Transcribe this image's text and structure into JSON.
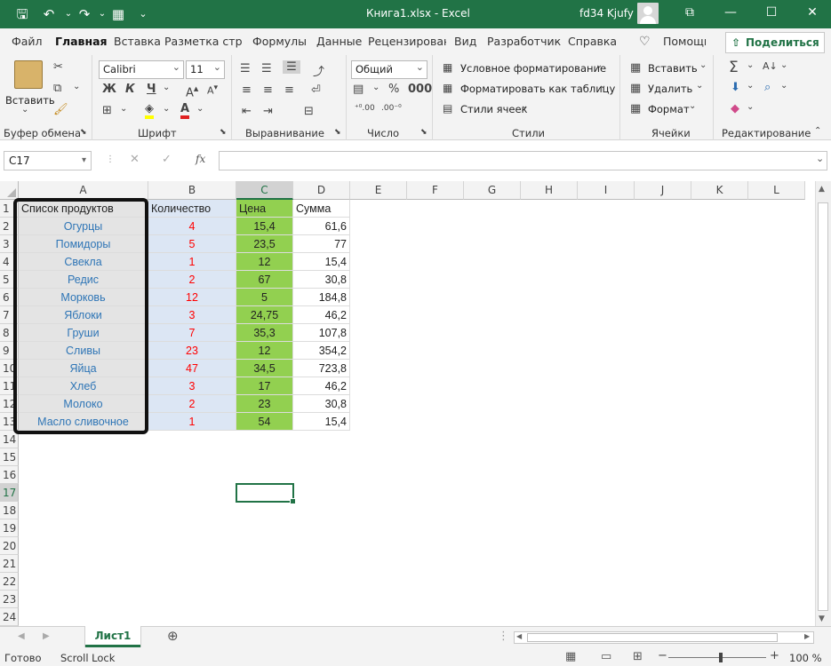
{
  "titlebar": {
    "file_title": "Книга1.xlsx  -  Excel",
    "user_name": "fd34 Kjufy"
  },
  "tabs": [
    "Файл",
    "Главная",
    "Вставка",
    "Разметка стра",
    "Формулы",
    "Данные",
    "Рецензирован",
    "Вид",
    "Разработчик",
    "Справка",
    "Помощн"
  ],
  "share_label": "Поделиться",
  "ribbon": {
    "clipboard": {
      "paste_label": "Вставить",
      "group": "Буфер обмена"
    },
    "font": {
      "name": "Calibri",
      "size": "11",
      "bold": "Ж",
      "italic": "К",
      "underline": "Ч",
      "group": "Шрифт"
    },
    "alignment": {
      "group": "Выравнивание"
    },
    "number": {
      "format": "Общий",
      "group": "Число"
    },
    "styles": {
      "cond_format": "Условное форматирование",
      "format_table": "Форматировать как таблицу",
      "cell_styles": "Стили ячеек",
      "group": "Стили"
    },
    "cells": {
      "insert": "Вставить",
      "delete": "Удалить",
      "format": "Формат",
      "group": "Ячейки"
    },
    "editing": {
      "group": "Редактирование"
    }
  },
  "formula_bar": {
    "name_box": "C17",
    "fx": "fx",
    "value": ""
  },
  "columns": [
    "A",
    "B",
    "C",
    "D",
    "E",
    "F",
    "G",
    "H",
    "I",
    "J",
    "K",
    "L"
  ],
  "rows": [
    "1",
    "2",
    "3",
    "4",
    "5",
    "6",
    "7",
    "8",
    "9",
    "10",
    "11",
    "12",
    "13",
    "14",
    "15",
    "16",
    "17",
    "18",
    "19",
    "20",
    "21",
    "22",
    "23",
    "24"
  ],
  "headers": {
    "a": "Список продуктов",
    "b": "Количество",
    "c": "Цена",
    "d": "Сумма"
  },
  "table": [
    {
      "product": "Огурцы",
      "qty": "4",
      "price": "15,4",
      "sum": "61,6"
    },
    {
      "product": "Помидоры",
      "qty": "5",
      "price": "23,5",
      "sum": "77"
    },
    {
      "product": "Свекла",
      "qty": "1",
      "price": "12",
      "sum": "15,4"
    },
    {
      "product": "Редис",
      "qty": "2",
      "price": "67",
      "sum": "30,8"
    },
    {
      "product": "Морковь",
      "qty": "12",
      "price": "5",
      "sum": "184,8"
    },
    {
      "product": "Яблоки",
      "qty": "3",
      "price": "24,75",
      "sum": "46,2"
    },
    {
      "product": "Груши",
      "qty": "7",
      "price": "35,3",
      "sum": "107,8"
    },
    {
      "product": "Сливы",
      "qty": "23",
      "price": "12",
      "sum": "354,2"
    },
    {
      "product": "Яйца",
      "qty": "47",
      "price": "34,5",
      "sum": "723,8"
    },
    {
      "product": "Хлеб",
      "qty": "3",
      "price": "17",
      "sum": "46,2"
    },
    {
      "product": "Молоко",
      "qty": "2",
      "price": "23",
      "sum": "30,8"
    },
    {
      "product": "Масло сливочное",
      "qty": "1",
      "price": "54",
      "sum": "15,4"
    }
  ],
  "sheets": [
    "Лист1"
  ],
  "status": {
    "ready": "Готово",
    "scroll_lock": "Scroll Lock",
    "zoom": "100 %",
    "zoom_minus": "−",
    "zoom_plus": "+"
  },
  "colors": {
    "excel_green": "#217346",
    "col_a_fill": "#e4e4e4",
    "col_b_fill": "#dce6f4",
    "col_c_fill": "#92d050",
    "product_text": "#2e75b6",
    "qty_text": "#ff0000"
  }
}
